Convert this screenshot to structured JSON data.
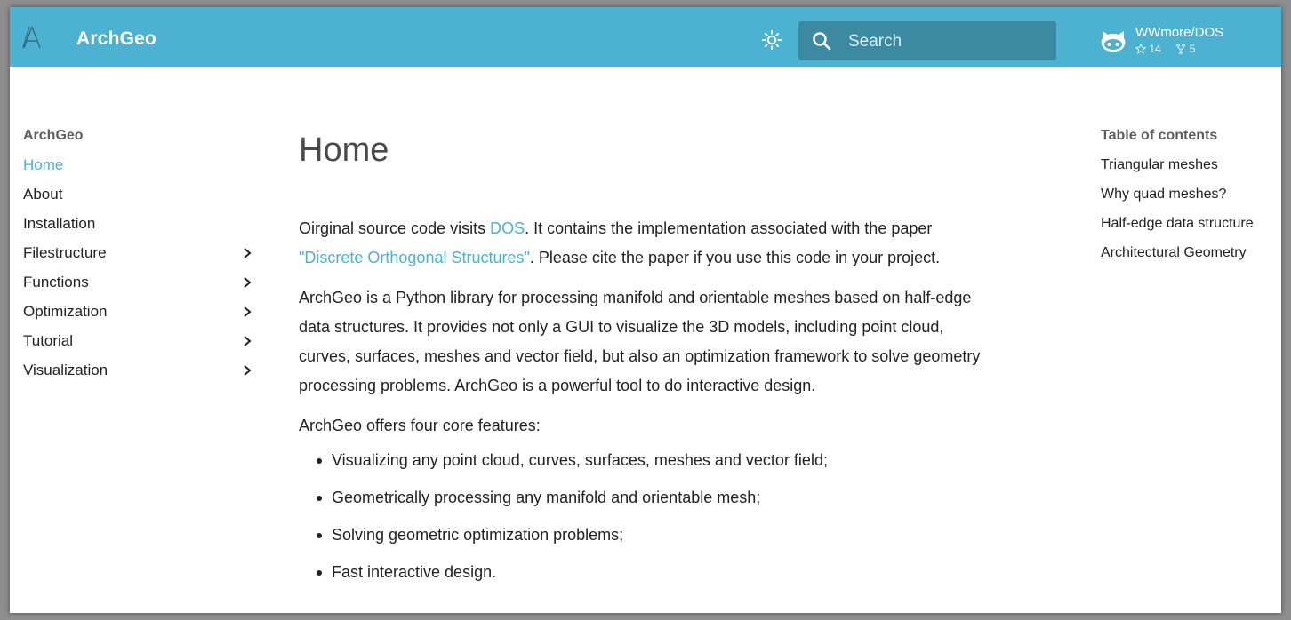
{
  "header": {
    "site_title": "ArchGeo",
    "accent_color": "#4db1d1",
    "search": {
      "placeholder": "Search",
      "value": ""
    },
    "repo": {
      "name": "WWmore/DOS",
      "stars": "14",
      "forks": "5"
    }
  },
  "nav": {
    "title": "ArchGeo",
    "items": [
      {
        "label": "Home",
        "active": true,
        "expandable": false
      },
      {
        "label": "About",
        "active": false,
        "expandable": false
      },
      {
        "label": "Installation",
        "active": false,
        "expandable": false
      },
      {
        "label": "Filestructure",
        "active": false,
        "expandable": true
      },
      {
        "label": "Functions",
        "active": false,
        "expandable": true
      },
      {
        "label": "Optimization",
        "active": false,
        "expandable": true
      },
      {
        "label": "Tutorial",
        "active": false,
        "expandable": true
      },
      {
        "label": "Visualization",
        "active": false,
        "expandable": true
      }
    ]
  },
  "main": {
    "title": "Home",
    "p1": {
      "text_before": "Oirginal source code visits ",
      "link1": "DOS",
      "text_mid": ". It contains the implementation associated with the paper",
      "link2": "\"Discrete Orthogonal Structures\"",
      "text_after": ". Please cite the paper if you use this code in your project."
    },
    "p2": {
      "line1": "ArchGeo is a Python library for processing manifold and orientable meshes based on half-edge",
      "line2": "data structures. It provides not only a GUI to visualize the 3D models, including point cloud,",
      "line3": "curves, surfaces, meshes and vector field, but also an optimization framework to solve geometry",
      "line4": "processing problems. ArchGeo is a powerful tool to do interactive design."
    },
    "p3": "ArchGeo offers four core features:",
    "features": [
      "Visualizing any point cloud, curves, surfaces, meshes and vector field;",
      "Geometrically processing any manifold and orientable mesh;",
      "Solving geometric optimization problems;",
      "Fast interactive design."
    ]
  },
  "toc": {
    "title": "Table of contents",
    "items": [
      "Triangular meshes",
      "Why quad meshes?",
      "Half-edge data structure",
      "Architectural Geometry"
    ]
  }
}
